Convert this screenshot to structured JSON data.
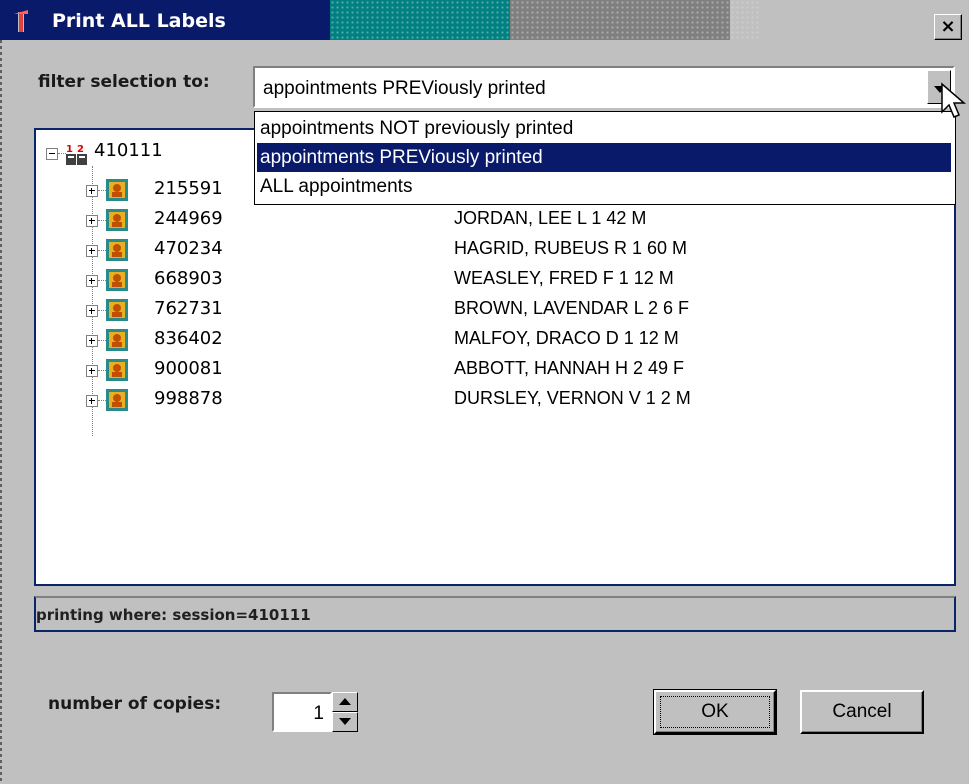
{
  "window": {
    "title": "Print ALL Labels",
    "close_glyph": "×",
    "colors": {
      "title_bg": "#0a1a6a",
      "selection": "#0a1a6a",
      "panel_border": "#0a246a",
      "face": "#c0c0c0"
    }
  },
  "filter": {
    "label": "filter selection to:",
    "selected": "appointments PREViously printed",
    "options": [
      "appointments NOT previously printed",
      "appointments PREViously printed",
      "ALL appointments"
    ],
    "selected_index": 1
  },
  "tree": {
    "root": {
      "id": "410111",
      "icon": "session-icon"
    },
    "children": [
      {
        "id": "215591",
        "name": "",
        "icon": "person-icon"
      },
      {
        "id": "244969",
        "name": "JORDAN, LEE  L 1 42 M",
        "icon": "person-icon"
      },
      {
        "id": "470234",
        "name": "HAGRID, RUBEUS  R 1 60 M",
        "icon": "person-icon"
      },
      {
        "id": "668903",
        "name": "WEASLEY, FRED  F 1 12 M",
        "icon": "person-icon"
      },
      {
        "id": "762731",
        "name": "BROWN, LAVENDAR  L 2 6 F",
        "icon": "person-icon"
      },
      {
        "id": "836402",
        "name": "MALFOY, DRACO  D 1 12 M",
        "icon": "person-icon"
      },
      {
        "id": "900081",
        "name": "ABBOTT, HANNAH  H 2 49 F",
        "icon": "person-icon"
      },
      {
        "id": "998878",
        "name": "DURSLEY, VERNON  V 1 2 M",
        "icon": "person-icon"
      }
    ]
  },
  "status": {
    "text": "printing where: session=410111"
  },
  "copies": {
    "label": "number of copies:",
    "value": "1"
  },
  "buttons": {
    "ok": "OK",
    "cancel": "Cancel"
  }
}
